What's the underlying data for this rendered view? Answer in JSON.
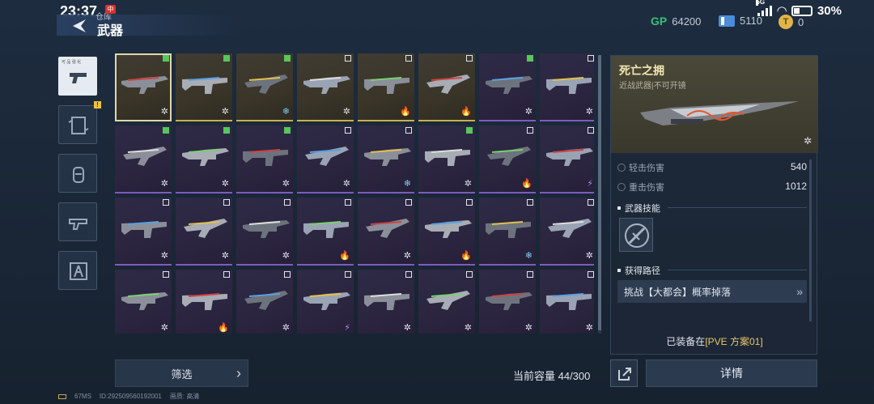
{
  "status": {
    "time": "23:37",
    "network": "5G",
    "battery": "30%"
  },
  "header": {
    "title": "武器",
    "subtitle": "仓库",
    "badge": "中"
  },
  "currencies": [
    {
      "icon": "gp-icon",
      "value": "64200"
    },
    {
      "icon": "ticket-icon",
      "value": "5110"
    },
    {
      "icon": "coin-icon",
      "value": "0"
    }
  ],
  "categories": [
    {
      "name": "pistol",
      "active": true,
      "tag": "可 品 强 化"
    },
    {
      "name": "card",
      "alert": "!"
    },
    {
      "name": "grenade"
    },
    {
      "name": "gun-part"
    },
    {
      "name": "character"
    }
  ],
  "weapons": [
    {
      "row": 0,
      "col": 0,
      "rarity": "gold",
      "checked": true,
      "element": "✲",
      "selected": true
    },
    {
      "row": 0,
      "col": 1,
      "rarity": "gold",
      "checked": true,
      "element": "✲"
    },
    {
      "row": 0,
      "col": 2,
      "rarity": "gold",
      "checked": true,
      "element": "❄"
    },
    {
      "row": 0,
      "col": 3,
      "rarity": "gold",
      "checked": false,
      "element": "✲"
    },
    {
      "row": 0,
      "col": 4,
      "rarity": "gold",
      "checked": false,
      "element": "🔥"
    },
    {
      "row": 0,
      "col": 5,
      "rarity": "gold",
      "checked": false,
      "element": "🔥"
    },
    {
      "row": 0,
      "col": 6,
      "rarity": "purple",
      "checked": true,
      "element": "✲"
    },
    {
      "row": 0,
      "col": 7,
      "rarity": "purple",
      "checked": false,
      "element": "✲"
    },
    {
      "row": 1,
      "col": 0,
      "rarity": "purple",
      "checked": true,
      "element": "✲"
    },
    {
      "row": 1,
      "col": 1,
      "rarity": "purple",
      "checked": true,
      "element": "✲"
    },
    {
      "row": 1,
      "col": 2,
      "rarity": "purple",
      "checked": true,
      "element": "✲"
    },
    {
      "row": 1,
      "col": 3,
      "rarity": "purple",
      "checked": false,
      "element": "✲"
    },
    {
      "row": 1,
      "col": 4,
      "rarity": "purple",
      "checked": false,
      "element": "❄"
    },
    {
      "row": 1,
      "col": 5,
      "rarity": "purple",
      "checked": true,
      "element": "✲"
    },
    {
      "row": 1,
      "col": 6,
      "rarity": "purple",
      "checked": false,
      "element": "🔥"
    },
    {
      "row": 1,
      "col": 7,
      "rarity": "purple",
      "checked": false,
      "element": "⚡"
    },
    {
      "row": 2,
      "col": 0,
      "rarity": "purple",
      "checked": false,
      "element": "✲"
    },
    {
      "row": 2,
      "col": 1,
      "rarity": "purple",
      "checked": false,
      "element": "✲"
    },
    {
      "row": 2,
      "col": 2,
      "rarity": "purple",
      "checked": false,
      "element": "✲"
    },
    {
      "row": 2,
      "col": 3,
      "rarity": "purple",
      "checked": false,
      "element": "🔥"
    },
    {
      "row": 2,
      "col": 4,
      "rarity": "purple",
      "checked": false,
      "element": "✲"
    },
    {
      "row": 2,
      "col": 5,
      "rarity": "purple",
      "checked": false,
      "element": "🔥"
    },
    {
      "row": 2,
      "col": 6,
      "rarity": "purple",
      "checked": false,
      "element": "❄"
    },
    {
      "row": 2,
      "col": 7,
      "rarity": "purple",
      "checked": false,
      "element": "✲"
    },
    {
      "row": 3,
      "col": 0,
      "rarity": "purple",
      "checked": false,
      "element": "✲"
    },
    {
      "row": 3,
      "col": 1,
      "rarity": "purple",
      "checked": false,
      "element": "🔥"
    },
    {
      "row": 3,
      "col": 2,
      "rarity": "purple",
      "checked": false,
      "element": "✲"
    },
    {
      "row": 3,
      "col": 3,
      "rarity": "purple",
      "checked": false,
      "element": "⚡"
    },
    {
      "row": 3,
      "col": 4,
      "rarity": "purple",
      "checked": false,
      "element": "✲"
    },
    {
      "row": 3,
      "col": 5,
      "rarity": "purple",
      "checked": false,
      "element": "✲"
    },
    {
      "row": 3,
      "col": 6,
      "rarity": "purple",
      "checked": false,
      "element": "✲"
    },
    {
      "row": 3,
      "col": 7,
      "rarity": "purple",
      "checked": false,
      "element": "✲"
    }
  ],
  "detail": {
    "name": "死亡之拥",
    "subtitle": "近战武器|不可开镜",
    "element": "✲",
    "stats": [
      {
        "label": "轻击伤害",
        "value": "540"
      },
      {
        "label": "重击伤害",
        "value": "1012"
      }
    ],
    "skill_title": "武器技能",
    "route_title": "获得路径",
    "route": "挑战【大都会】概率掉落",
    "route_chevron": "»",
    "equipped_prefix": "已装备在",
    "equipped_loadout": "[PVE 方案01]"
  },
  "bottom": {
    "filter": "筛选",
    "filter_chevron": "›",
    "capacity": "当前容量 44/300",
    "details": "详情"
  },
  "footer": {
    "ping": "67MS",
    "id": "ID:292509560192001",
    "quality": "画质: 高清"
  },
  "colors": {
    "gold": "#cbb04e",
    "purple": "#7e5bbd",
    "accent": "#e9c96a"
  }
}
